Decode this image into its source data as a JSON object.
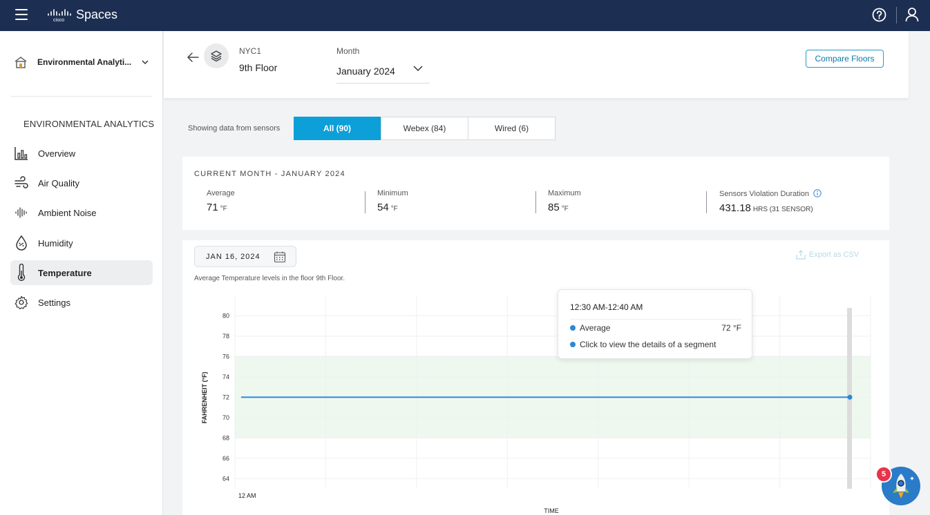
{
  "header": {
    "app_title": "Spaces",
    "brand": "cisco"
  },
  "sidebar": {
    "org_name": "Environmental Analyti...",
    "section_title": "ENVIRONMENTAL ANALYTICS",
    "items": [
      {
        "label": "Overview",
        "icon": "overview-chart-icon"
      },
      {
        "label": "Air Quality",
        "icon": "wind-icon"
      },
      {
        "label": "Ambient Noise",
        "icon": "sound-wave-icon"
      },
      {
        "label": "Humidity",
        "icon": "droplet-icon"
      },
      {
        "label": "Temperature",
        "icon": "thermometer-icon",
        "active": true
      },
      {
        "label": "Settings",
        "icon": "gear-icon"
      }
    ]
  },
  "page_header": {
    "site": "NYC1",
    "floor": "9th Floor",
    "month_label": "Month",
    "month_value": "January 2024",
    "compare_label": "Compare Floors"
  },
  "filter": {
    "label": "Showing data from sensors",
    "options": [
      {
        "label": "All (90)",
        "active": true
      },
      {
        "label": "Webex (84)"
      },
      {
        "label": "Wired (6)"
      }
    ]
  },
  "stats": {
    "title": "CURRENT MONTH - JANUARY 2024",
    "average": {
      "label": "Average",
      "value": "71",
      "unit": "°F"
    },
    "minimum": {
      "label": "Minimum",
      "value": "54",
      "unit": "°F"
    },
    "maximum": {
      "label": "Maximum",
      "value": "85",
      "unit": "°F"
    },
    "violation": {
      "label": "Sensors Violation Duration",
      "value": "431.18",
      "unit": "HRS (31 SENSOR)"
    }
  },
  "chart_panel": {
    "date": "JAN 16, 2024",
    "export_label": "Export as CSV",
    "description": "Average Temperature levels in the floor 9th Floor."
  },
  "chart_data": {
    "type": "line",
    "ylabel": "FAHRENHEIT (°F)",
    "xlabel": "TIME",
    "ylim": [
      63,
      82
    ],
    "yticks": [
      64,
      66,
      68,
      70,
      72,
      74,
      76,
      78,
      80
    ],
    "xticks": [
      "12 AM"
    ],
    "comfort_band": [
      68,
      76
    ],
    "series": [
      {
        "values": [
          72,
          72,
          72,
          72,
          72,
          72,
          72,
          72,
          72,
          72,
          72,
          72,
          72,
          72,
          72,
          72,
          72,
          72,
          72,
          72,
          72,
          72,
          72,
          72,
          72,
          72,
          72,
          72,
          72,
          72,
          72,
          72,
          72,
          72,
          72,
          72,
          72,
          72,
          72,
          72,
          72,
          72,
          72,
          72,
          72,
          72,
          72,
          72,
          72,
          72,
          72,
          72,
          72,
          72,
          72,
          72,
          72,
          72,
          72,
          72
        ]
      }
    ],
    "line_color": "#2d87d6",
    "band_color": "#eef8ef"
  },
  "tooltip": {
    "title": "12:30 AM-12:40 AM",
    "rows": [
      {
        "label": "Average",
        "value": "72 °F"
      },
      {
        "label": "Click to view the details of a segment"
      }
    ]
  },
  "assistant": {
    "badge_count": "5"
  }
}
